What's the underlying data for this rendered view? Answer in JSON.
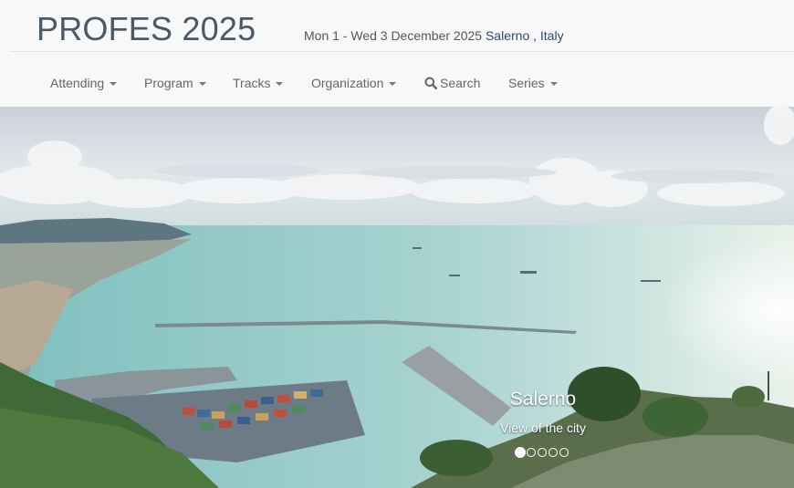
{
  "header": {
    "title": "PROFES 2025",
    "dates_prefix": "Mon 1 - Wed 3 December 2025",
    "location": "Salerno , Italy"
  },
  "nav": {
    "items": [
      {
        "label": "Attending",
        "icon": "caret-down-icon"
      },
      {
        "label": "Program",
        "icon": "caret-down-icon"
      },
      {
        "label": "Tracks",
        "icon": "caret-down-icon"
      },
      {
        "label": "Organization",
        "icon": "caret-down-icon"
      },
      {
        "label": "Search",
        "icon": "search-icon"
      },
      {
        "label": "Series",
        "icon": "caret-down-icon"
      }
    ]
  },
  "carousel": {
    "caption_title": "Salerno",
    "caption_subtitle": "View of the city",
    "slide_count": 5,
    "active_slide": 1
  },
  "colors": {
    "title": "#4a5968",
    "location_link": "#2a4a74",
    "nav_text": "#666666",
    "header_bg": "#f8f8f8"
  }
}
